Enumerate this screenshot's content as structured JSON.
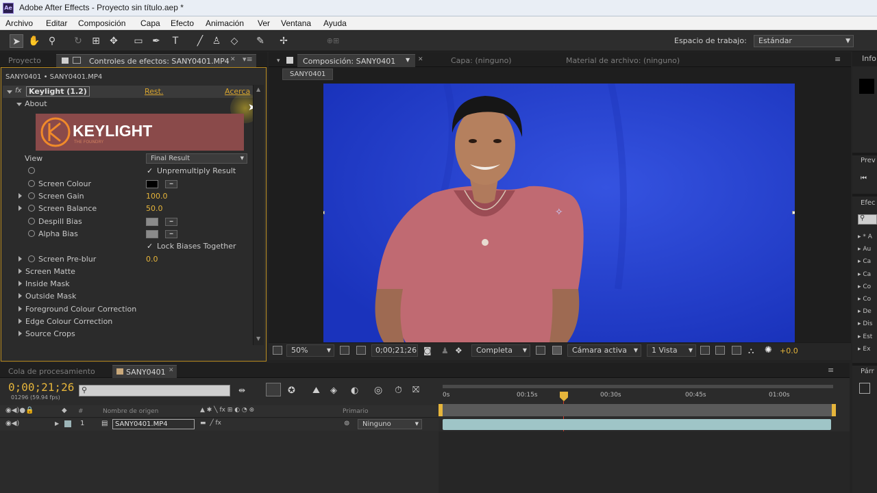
{
  "titlebar": {
    "app_icon_text": "Ae",
    "title": "Adobe After Effects - Proyecto sin título.aep *"
  },
  "menu": [
    "Archivo",
    "Editar",
    "Composición",
    "Capa",
    "Efecto",
    "Animación",
    "Ver",
    "Ventana",
    "Ayuda"
  ],
  "toolbar": {
    "workspace_label": "Espacio de trabajo:",
    "workspace_value": "Estándar"
  },
  "left_panel": {
    "tab_project": "Proyecto",
    "tab_effects": "Controles de efectos: SANY0401.MP4",
    "breadcrumb": "SANY0401 • SANY0401.MP4",
    "effect_name": "Keylight (1.2)",
    "reset_label": "Rest.",
    "about_link": "Acerca",
    "about_group": "About",
    "logo_text": "KEYLIGHT",
    "logo_sub": "THE FOUNDRY",
    "view_label": "View",
    "view_value": "Final Result",
    "unpremultiply": "Unpremultiply Result",
    "screen_colour": "Screen Colour",
    "screen_gain_label": "Screen Gain",
    "screen_gain_value": "100.0",
    "screen_balance_label": "Screen Balance",
    "screen_balance_value": "50.0",
    "despill_bias": "Despill Bias",
    "alpha_bias": "Alpha Bias",
    "lock_biases": "Lock Biases Together",
    "screen_preblur_label": "Screen Pre-blur",
    "screen_preblur_value": "0.0",
    "groups": [
      "Screen Matte",
      "Inside Mask",
      "Outside Mask",
      "Foreground Colour Correction",
      "Edge Colour Correction",
      "Source Crops"
    ]
  },
  "viewer": {
    "tab_comp": "Composición: SANY0401",
    "tab_layer": "Capa: (ninguno)",
    "tab_footage": "Material de archivo: (ninguno)",
    "comp_name": "SANY0401",
    "zoom": "50%",
    "timecode": "0;00;21;26",
    "resolution": "Completa",
    "camera": "Cámara activa",
    "views": "1 Vista",
    "exposure": "+0.0"
  },
  "timeline": {
    "tab_queue": "Cola de procesamiento",
    "tab_comp": "SANY0401",
    "timecode": "0;00;21;26",
    "frames": "01296 (59.94 fps)",
    "col_source": "Nombre de origen",
    "col_parent": "Primario",
    "layer_index": "1",
    "layer_name": "SANY0401.MP4",
    "parent_value": "Ninguno",
    "ruler": [
      "0s",
      "00:15s",
      "00:30s",
      "00:45s",
      "01:00s"
    ]
  },
  "right_panel": {
    "info": "Info",
    "preview": "Prev",
    "effects": "Efec",
    "params": "Párr"
  },
  "colors": {
    "accent": "#e6b53b",
    "screen_blue": "#2a47d6",
    "layer_bar": "#9fc5c7"
  }
}
